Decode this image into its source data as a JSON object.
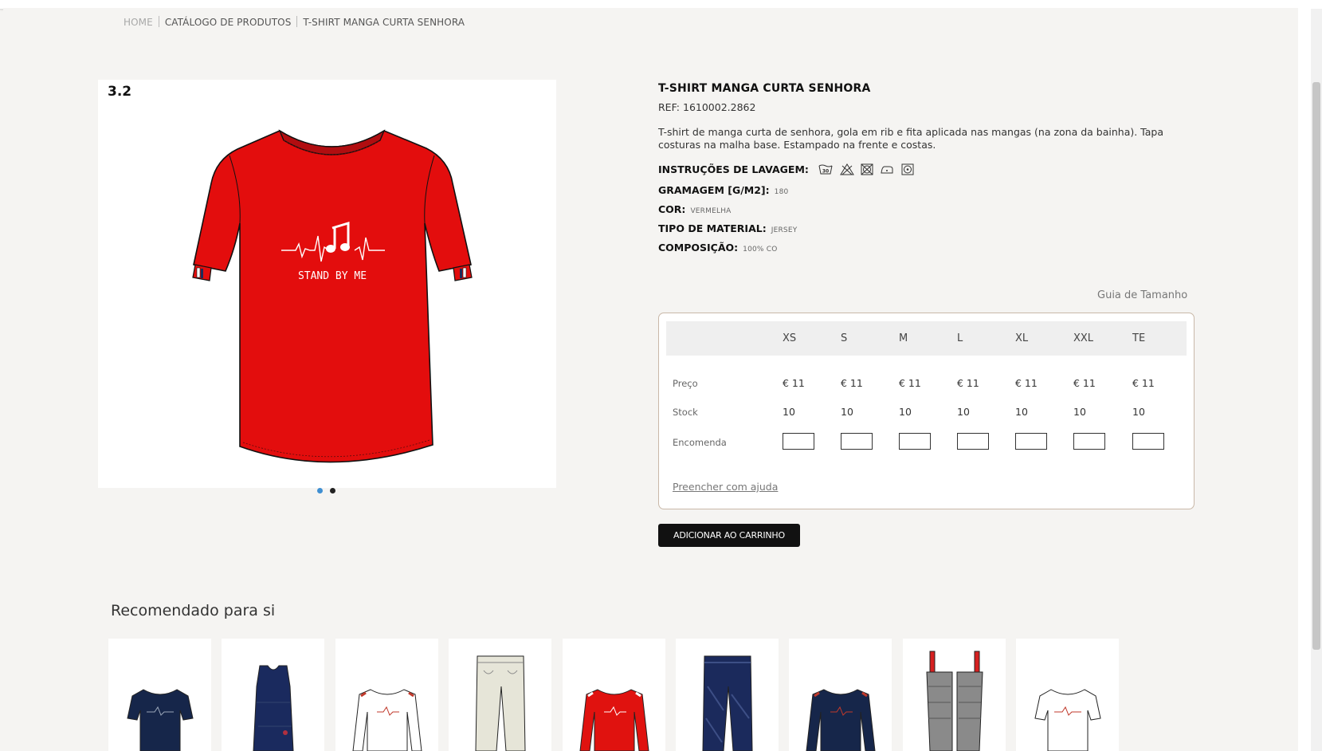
{
  "breadcrumb": {
    "home": "HOME",
    "catalog": "CATÁLOGO DE PRODUTOS",
    "current": "T-SHIRT MANGA CURTA SENHORA"
  },
  "gallery": {
    "slide_number": "3.2",
    "print_text": "STAND BY ME",
    "dot_colors": [
      "#3f8fd2",
      "#222222"
    ],
    "garment_color": "#e30d0d"
  },
  "product": {
    "title": "T-SHIRT MANGA CURTA SENHORA",
    "ref": "REF: 1610002.2862",
    "description": "T-shirt de manga curta de senhora, gola em rib e fita aplicada nas mangas (na zona da bainha). Tapa costuras na malha base. Estampado na frente e costas.",
    "wash_label": "INSTRUÇÕES DE LAVAGEM:",
    "wash_icons": [
      "wash-30-icon",
      "no-bleach-icon",
      "no-tumble-dry-icon",
      "iron-low-icon",
      "dry-clean-icon"
    ],
    "wash_temp": "30",
    "weight_label": "GRAMAGEM [G/M2]:",
    "weight_value": "180",
    "color_label": "COR:",
    "color_value": "VERMELHA",
    "material_label": "TIPO DE MATERIAL:",
    "material_value": "JERSEY",
    "composition_label": "COMPOSIÇÃO:",
    "composition_value": "100% CO"
  },
  "size_guide": "Guia de Tamanho",
  "sizes": {
    "headers": [
      "XS",
      "S",
      "M",
      "L",
      "XL",
      "XXL",
      "TE"
    ],
    "price_label": "Preço",
    "prices": [
      "€ 11",
      "€ 11",
      "€ 11",
      "€ 11",
      "€ 11",
      "€ 11",
      "€ 11"
    ],
    "stock_label": "Stock",
    "stock": [
      "10",
      "10",
      "10",
      "10",
      "10",
      "10",
      "10"
    ],
    "order_label": "Encomenda",
    "help_link": "Preencher com ajuda"
  },
  "cart_button": "ADICIONAR AO CARRINHO",
  "recommended": {
    "title": "Recomendado para si",
    "items": [
      {
        "type": "tshirt",
        "color": "#16264a",
        "accent": "#9aa6b8"
      },
      {
        "type": "dress",
        "color": "#1a2a5e",
        "accent": "#b03040"
      },
      {
        "type": "longsleeve",
        "color": "#ffffff",
        "accent": "#c0392b"
      },
      {
        "type": "pants",
        "color": "#e6e5d8",
        "accent": "#888888"
      },
      {
        "type": "longsleeve",
        "color": "#e0120f",
        "accent": "#ffffff"
      },
      {
        "type": "jeans",
        "color": "#1b2a5c",
        "accent": "#3d4f86"
      },
      {
        "type": "longsleeve",
        "color": "#16264a",
        "accent": "#c0392b"
      },
      {
        "type": "dungaree",
        "color": "#8a8a8a",
        "accent": "#d62020"
      },
      {
        "type": "tshirt",
        "color": "#ffffff",
        "accent": "#c0392b"
      }
    ]
  }
}
